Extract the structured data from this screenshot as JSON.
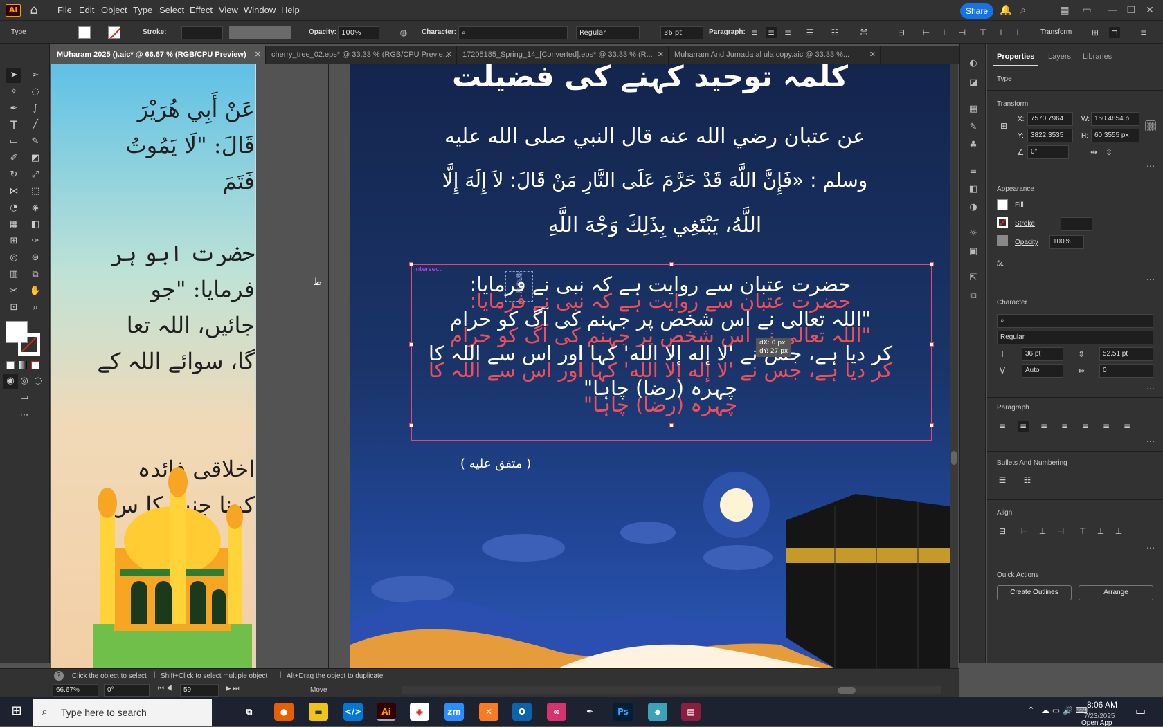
{
  "app": {
    "logo": "Ai"
  },
  "menu": [
    "File",
    "Edit",
    "Object",
    "Type",
    "Select",
    "Effect",
    "View",
    "Window",
    "Help"
  ],
  "share_label": "Share",
  "control_bar": {
    "type_label": "Type",
    "stroke_label": "Stroke:",
    "opacity_label": "Opacity:",
    "opacity_value": "100%",
    "character_label": "Character:",
    "font_style": "Regular",
    "font_size": "36 pt",
    "paragraph_label": "Paragraph:",
    "transform_label": "Transform"
  },
  "tabs": [
    {
      "label": "MUharam 2025 ().aic* @ 66.67 % (RGB/CPU Preview)",
      "active": true
    },
    {
      "label": "cherry_tree_02.eps* @ 33.33 % (RGB/CPU Previe...",
      "active": false
    },
    {
      "label": "17205185_Spring_14_[Converted].eps* @ 33.33 % (R...",
      "active": false
    },
    {
      "label": "Muharram And Jumada al ula copy.aic @ 33.33 %...",
      "active": false
    }
  ],
  "artboard_left": {
    "text": "عَنْ أَبِي هُرَيْرَ\nقَالَ: \"لَا يَمُوتُ\nفَتَمَ\n\nحضرت ابو ہر\nفرمایا: \"جو\nجائیں، اللہ تعا\nگا، سوائے اللہ کے\n\n\nاخلاقی فائدہ\nکرنا جنت کا س"
  },
  "artboard_right": {
    "title": "کلمہ توحید کہنے کی فضیلت",
    "arabic_lines": [
      "عن عتبان رضي الله عنه قال النبي صلى الله عليه",
      "وسلم : «فَإِنَّ اللَّهَ قَدْ حَرَّمَ عَلَى النَّارِ مَنْ قَالَ: لاَ إِلَهَ إِلَّا",
      "اللَّهُ، يَبْتَغِي بِذَلِكَ وَجْهَ اللَّهِ"
    ],
    "urdu_lines": [
      "حضرت عتبان سے روایت ہے کہ نبی  نے فرمایا:",
      "\"اللہ تعالی نے اس شخص پر جہنم کی آگ کو حرام",
      "کر دیا ہے، جس نے 'لا إله إلا الله' کہا اور اس سے اللہ کا",
      "چہرہ (رضا) چاہا\""
    ],
    "reference": "( متفق عليه )",
    "intersect_label": "intersect",
    "drag_tooltip": {
      "dx": "dX: 0 px",
      "dy": "dY: 27 px"
    },
    "cursor_glyph": "ط"
  },
  "status": {
    "hint_1": "Click the object to select",
    "hint_2": "Shift+Click to select multiple object",
    "hint_3": "Alt+Drag the object to duplicate",
    "zoom": "66.67%",
    "rotate": "0°",
    "page": "59",
    "tool": "Move"
  },
  "properties": {
    "tabs": [
      "Properties",
      "Layers",
      "Libraries"
    ],
    "selection_type": "Type",
    "transform_title": "Transform",
    "x_label": "X:",
    "x_value": "7570.7964",
    "y_label": "Y:",
    "y_value": "3822.3535",
    "w_label": "W:",
    "w_value": "150.4854 p",
    "h_label": "H:",
    "h_value": "60.3555 px",
    "angle": "0°",
    "appearance_title": "Appearance",
    "fill_label": "Fill",
    "stroke_label": "Stroke",
    "opacity_label": "Opacity",
    "opacity_value": "100%",
    "fx_label": "fx.",
    "character_title": "Character",
    "font_style": "Regular",
    "font_size": "36 pt",
    "leading": "52.51 pt",
    "kerning": "Auto",
    "tracking": "0",
    "paragraph_title": "Paragraph",
    "bullets_title": "Bullets And Numbering",
    "align_title": "Align",
    "quick_actions_title": "Quick Actions",
    "create_outlines": "Create Outlines",
    "arrange": "Arrange"
  },
  "taskbar": {
    "search_placeholder": "Type here to search",
    "time": "8:06 AM",
    "date": "7/23/2025",
    "open_app": "Open App"
  },
  "colors": {
    "accent": "#1473e6",
    "selection": "#e0457b",
    "ghost_text": "#ef4f5a"
  }
}
